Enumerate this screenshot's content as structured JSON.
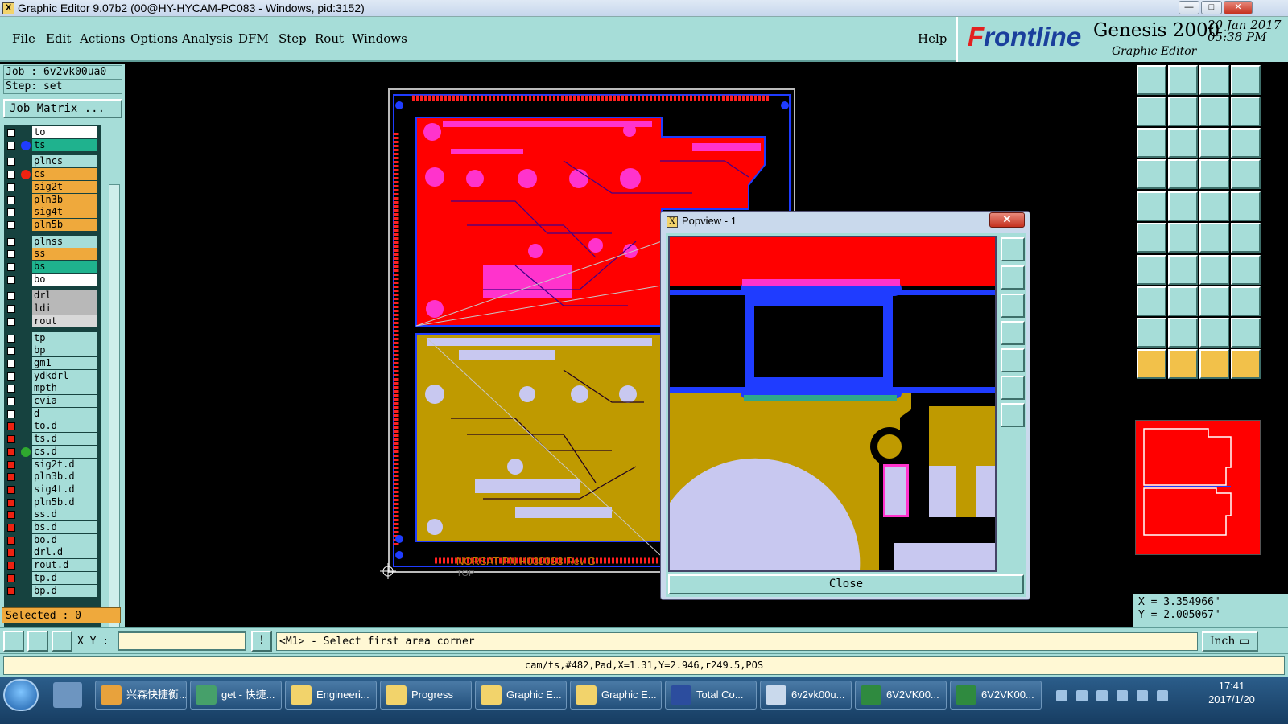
{
  "window": {
    "title": "Graphic Editor 9.07b2 (00@HY-HYCAM-PC083 - Windows, pid:3152)",
    "icon_text": "X"
  },
  "menu": {
    "items": [
      "File",
      "Edit",
      "Actions",
      "Options",
      "Analysis",
      "DFM",
      "Step",
      "Rout",
      "Windows"
    ],
    "help": "Help"
  },
  "brand": {
    "logo_prefix": "F",
    "logo_rest": "rontline",
    "product": "Genesis 2000",
    "subtitle": "Graphic Editor",
    "date": "20 Jan 2017",
    "time": "05:38 PM"
  },
  "job": {
    "job_label": "Job : 6v2vk00ua0",
    "step_label": "Step: set",
    "matrix_button": "Job Matrix ..."
  },
  "layers": [
    {
      "name": "to",
      "color": "#ffffff",
      "mark": "",
      "cb": "white"
    },
    {
      "name": "ts",
      "color": "#1fb28e",
      "mark": "#1f3cff",
      "cb": "white"
    },
    {
      "name": "plncs",
      "color": "#a6ddd8",
      "mark": "",
      "cb": "white"
    },
    {
      "name": "cs",
      "color": "#efa93c",
      "mark": "#e21",
      "cb": "white"
    },
    {
      "name": "sig2t",
      "color": "#efa93c",
      "mark": "",
      "cb": "white"
    },
    {
      "name": "pln3b",
      "color": "#efa93c",
      "mark": "",
      "cb": "white"
    },
    {
      "name": "sig4t",
      "color": "#efa93c",
      "mark": "",
      "cb": "white"
    },
    {
      "name": "pln5b",
      "color": "#efa93c",
      "mark": "",
      "cb": "white"
    },
    {
      "name": "plnss",
      "color": "#a6ddd8",
      "mark": "",
      "cb": "white"
    },
    {
      "name": "ss",
      "color": "#efa93c",
      "mark": "",
      "cb": "white"
    },
    {
      "name": "bs",
      "color": "#1fb28e",
      "mark": "",
      "cb": "white"
    },
    {
      "name": "bo",
      "color": "#ffffff",
      "mark": "",
      "cb": "white"
    },
    {
      "name": "drl",
      "color": "#b8b8b8",
      "mark": "",
      "cb": "white"
    },
    {
      "name": "ldi",
      "color": "#b8b8b8",
      "mark": "",
      "cb": "white"
    },
    {
      "name": "rout",
      "color": "#d8d8d8",
      "mark": "",
      "cb": "white"
    },
    {
      "name": "tp",
      "color": "#a6ddd8",
      "mark": "",
      "cb": "white"
    },
    {
      "name": "bp",
      "color": "#a6ddd8",
      "mark": "",
      "cb": "white"
    },
    {
      "name": "gm1",
      "color": "#a6ddd8",
      "mark": "",
      "cb": "white"
    },
    {
      "name": "ydkdrl",
      "color": "#a6ddd8",
      "mark": "",
      "cb": "white"
    },
    {
      "name": "mpth",
      "color": "#a6ddd8",
      "mark": "",
      "cb": "white"
    },
    {
      "name": "cvia",
      "color": "#a6ddd8",
      "mark": "",
      "cb": "white"
    },
    {
      "name": "d",
      "color": "#a6ddd8",
      "mark": "",
      "cb": "white"
    },
    {
      "name": "to.d",
      "color": "#a6ddd8",
      "mark": "",
      "cb": "red"
    },
    {
      "name": "ts.d",
      "color": "#a6ddd8",
      "mark": "",
      "cb": "red"
    },
    {
      "name": "cs.d",
      "color": "#a6ddd8",
      "mark": "#2fa82f",
      "cb": "red"
    },
    {
      "name": "sig2t.d",
      "color": "#a6ddd8",
      "mark": "",
      "cb": "red"
    },
    {
      "name": "pln3b.d",
      "color": "#a6ddd8",
      "mark": "",
      "cb": "red"
    },
    {
      "name": "sig4t.d",
      "color": "#a6ddd8",
      "mark": "",
      "cb": "red"
    },
    {
      "name": "pln5b.d",
      "color": "#a6ddd8",
      "mark": "",
      "cb": "red"
    },
    {
      "name": "ss.d",
      "color": "#a6ddd8",
      "mark": "",
      "cb": "red"
    },
    {
      "name": "bs.d",
      "color": "#a6ddd8",
      "mark": "",
      "cb": "red"
    },
    {
      "name": "bo.d",
      "color": "#a6ddd8",
      "mark": "",
      "cb": "red"
    },
    {
      "name": "drl.d",
      "color": "#a6ddd8",
      "mark": "",
      "cb": "red"
    },
    {
      "name": "rout.d",
      "color": "#a6ddd8",
      "mark": "",
      "cb": "red"
    },
    {
      "name": "tp.d",
      "color": "#a6ddd8",
      "mark": "",
      "cb": "red"
    },
    {
      "name": "bp.d",
      "color": "#a6ddd8",
      "mark": "",
      "cb": "red"
    }
  ],
  "selected": "Selected : 0",
  "board": {
    "silk_text": "NORSAT PN H0390S3 Rev G",
    "side_text": "TOP"
  },
  "popview": {
    "title": "Popview - 1",
    "close_x": "✕",
    "close_label": "Close"
  },
  "coords": {
    "x": "X = 3.354966\"",
    "y": "Y = 2.005067\""
  },
  "input": {
    "xy_label": "X Y :",
    "xy_value": "",
    "prompt": "<M1> - Select first area corner",
    "unit": "Inch"
  },
  "status": "cam/ts,#482,Pad,X=1.31,Y=2.946,r249.5,POS",
  "taskbar": {
    "tasks": [
      {
        "label": "兴森快捷衡...",
        "color": "#e8a23c"
      },
      {
        "label": "get - 快捷...",
        "color": "#46a06a"
      },
      {
        "label": "Engineeri...",
        "color": "#f2d36b"
      },
      {
        "label": "Progress",
        "color": "#f2d36b"
      },
      {
        "label": "Graphic E...",
        "color": "#f2d36b"
      },
      {
        "label": "Graphic E...",
        "color": "#f2d36b"
      },
      {
        "label": "Total Co...",
        "color": "#2c4d9e"
      },
      {
        "label": "6v2vk00u...",
        "color": "#c9d9ec"
      },
      {
        "label": "6V2VK00...",
        "color": "#2f8a3f"
      },
      {
        "label": "6V2VK00...",
        "color": "#2f8a3f"
      }
    ],
    "clock_time": "17:41",
    "clock_date": "2017/1/20"
  },
  "colors": {
    "panel": "#a6ddd8",
    "top_copper": "#ff0000",
    "bottom_copper": "#bf9a00",
    "pads": "#ff33cc",
    "outline": "#1f3cff"
  }
}
